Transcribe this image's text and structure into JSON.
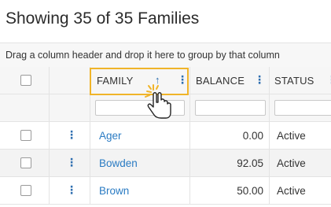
{
  "page": {
    "title": "Showing 35 of 35 Families",
    "group_hint": "Drag a column header and drop it here to group by that column"
  },
  "grid": {
    "columns": {
      "family": {
        "label": "FAMILY",
        "sort": "ascending",
        "sort_icon": "arrow-up-icon"
      },
      "balance": {
        "label": "BALANCE"
      },
      "status": {
        "label": "STATUS"
      }
    },
    "filters": {
      "family": "",
      "balance": "",
      "status": ""
    },
    "rows": [
      {
        "family": "Ager",
        "balance": "0.00",
        "status": "Active"
      },
      {
        "family": "Bowden",
        "balance": "92.05",
        "status": "Active"
      },
      {
        "family": "Brown",
        "balance": "50.00",
        "status": "Active"
      }
    ]
  },
  "colors": {
    "highlight": "#f0b429",
    "link": "#2a7bc3",
    "accent_icon": "#2f6fb0",
    "cursor_burst": "#f0b429"
  }
}
